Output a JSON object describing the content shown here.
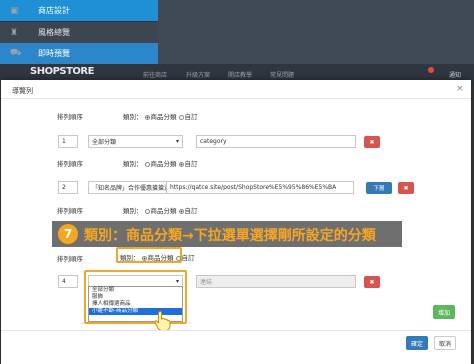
{
  "sidebar": {
    "items": [
      {
        "label": "商店設計",
        "icon": "store-icon"
      },
      {
        "label": "風格總覽",
        "icon": "palette-icon"
      },
      {
        "label": "即時預覽",
        "icon": "cart-icon"
      }
    ]
  },
  "topbar": {
    "logo": "SHOPSTORE",
    "nav": [
      "前往商店",
      "升級方案",
      "開店教學",
      "常見問題"
    ],
    "notification_count": "5",
    "user": "通知"
  },
  "modal": {
    "title": "導覽列",
    "close": "×",
    "sort_label": "排列順序",
    "type_label": "類別：",
    "type_option_product": "商品分類",
    "type_option_custom": "自訂",
    "rows": [
      {
        "order": "1",
        "select": "全部分類",
        "text": "category",
        "delete": "✖"
      },
      {
        "order": "2",
        "select": "「知名品牌」合作優惠搶搶送！",
        "text": "https://qatce.site/post/ShopStore%E5%95%86%E5%BA",
        "delete": "✖",
        "action": "下層"
      },
      {
        "order": "4",
        "select": "",
        "text": "連結",
        "delete": "✖"
      }
    ],
    "dropdown_options": [
      "全部分類",
      "服飾",
      "擇人相傳選商品",
      "小雛不斷-商品分類"
    ],
    "add_button": "增加",
    "confirm_button": "確定",
    "cancel_button": "取消"
  },
  "tutorial": {
    "step": "7",
    "text": "類別：商品分類→下拉選單選擇剛所設定的分類"
  },
  "colors": {
    "highlight": "#f5a623",
    "primary": "#337ab7",
    "danger": "#d9534f",
    "success": "#5cb85c",
    "sidebar_active": "#1f8fd6"
  }
}
